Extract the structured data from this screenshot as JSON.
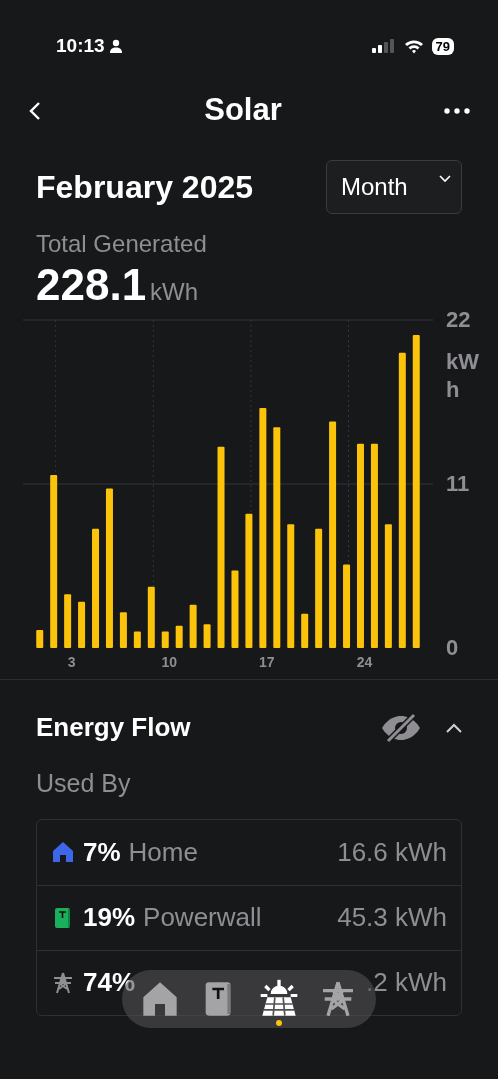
{
  "status_bar": {
    "time": "10:13",
    "battery": "79"
  },
  "header": {
    "title": "Solar"
  },
  "period": {
    "title": "February 2025",
    "range_button": "Month"
  },
  "summary": {
    "label": "Total Generated",
    "value": "228.1",
    "unit": "kWh"
  },
  "chart": {
    "chart_data": {
      "type": "bar",
      "x": [
        1,
        2,
        3,
        4,
        5,
        6,
        7,
        8,
        9,
        10,
        11,
        12,
        13,
        14,
        15,
        16,
        17,
        18,
        19,
        20,
        21,
        22,
        23,
        24,
        25,
        26,
        27,
        28
      ],
      "series": [
        {
          "color": "#fcc30b",
          "values": [
            1.2,
            11.6,
            3.6,
            3.1,
            8.0,
            10.7,
            2.4,
            1.1,
            4.1,
            1.1,
            1.5,
            2.9,
            1.6,
            13.5,
            5.2,
            9.0,
            16.1,
            14.8,
            8.3,
            2.3,
            8.0,
            15.2,
            5.6,
            13.7,
            13.7,
            8.3,
            19.8,
            21.0
          ]
        }
      ],
      "xlim": [
        -0.2,
        29.2
      ],
      "ylim": [
        0,
        22
      ],
      "ylabel": "kWh",
      "xticks": [
        3,
        10,
        17,
        24
      ],
      "yticks": [
        0,
        11,
        22
      ]
    }
  },
  "energy_flow": {
    "title": "Energy Flow",
    "subtitle": "Used By",
    "expanded": true,
    "rows": [
      {
        "kind": "home",
        "color": "#3d67e8",
        "percent": "7%",
        "name": "Home",
        "value": "16.6 kWh"
      },
      {
        "kind": "powerwall",
        "color": "#1aaf5d",
        "percent": "19%",
        "name": "Powerwall",
        "value": "45.3 kWh"
      },
      {
        "kind": "grid",
        "color": "#8e8e93",
        "percent": "74%",
        "value": ".2 kWh"
      }
    ]
  },
  "tab_bar": [
    {
      "kind": "home",
      "selected": false
    },
    {
      "kind": "powerwall",
      "selected": false
    },
    {
      "kind": "solar",
      "selected": true
    },
    {
      "kind": "grid",
      "selected": false
    }
  ]
}
